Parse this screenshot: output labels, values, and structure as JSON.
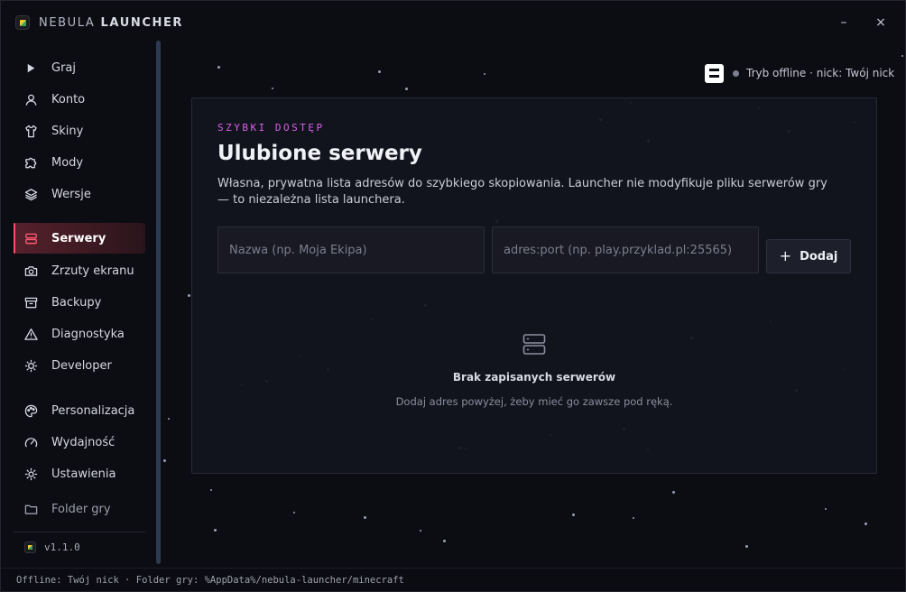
{
  "app": {
    "title_first": "NEBULA",
    "title_second": "LAUNCHER",
    "window_controls": {
      "minimize": "–",
      "close": "×"
    }
  },
  "sidebar": {
    "items": [
      {
        "label": "Graj",
        "icon": "play-icon"
      },
      {
        "label": "Konto",
        "icon": "user-icon"
      },
      {
        "label": "Skiny",
        "icon": "shirt-icon"
      },
      {
        "label": "Mody",
        "icon": "puzzle-icon"
      },
      {
        "label": "Wersje",
        "icon": "layers-icon"
      },
      {
        "label": "Serwery",
        "icon": "server-icon",
        "active": true
      },
      {
        "label": "Zrzuty ekranu",
        "icon": "camera-icon"
      },
      {
        "label": "Backupy",
        "icon": "archive-icon"
      },
      {
        "label": "Diagnostyka",
        "icon": "warning-icon"
      },
      {
        "label": "Developer",
        "icon": "bug-icon"
      },
      {
        "label": "Personalizacja",
        "icon": "palette-icon"
      },
      {
        "label": "Wydajność",
        "icon": "gauge-icon"
      },
      {
        "label": "Ustawienia",
        "icon": "gear-icon"
      },
      {
        "label": "Folder gry",
        "icon": "folder-icon"
      }
    ],
    "version": "v1.1.0"
  },
  "status": {
    "text": "Tryb offline · nick: Twój nick"
  },
  "main": {
    "eyebrow": "SZYBKI DOSTĘP",
    "title": "Ulubione serwery",
    "description": "Własna, prywatna lista adresów do szybkiego skopiowania. Launcher nie modyfikuje pliku serwerów gry — to niezależna lista launchera.",
    "name_placeholder": "Nazwa (np. Moja Ekipa)",
    "address_placeholder": "adres:port (np. play.przyklad.pl:25565)",
    "add_label": "Dodaj",
    "empty_title": "Brak zapisanych serwerów",
    "empty_subtitle": "Dodaj adres powyżej, żeby mieć go zawsze pod ręką."
  },
  "footer": {
    "text": "Offline: Twój nick · Folder gry: %AppData%/nebula-launcher/minecraft"
  },
  "colors": {
    "accent": "#ff4d67",
    "eyebrow": "#d760e8",
    "background": "#0c0d13"
  }
}
